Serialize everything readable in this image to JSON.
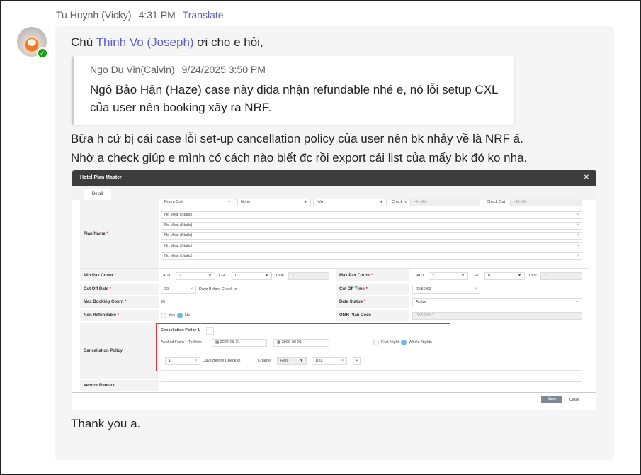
{
  "message": {
    "sender": "Tu Huynh (Vicky)",
    "time": "4:31 PM",
    "translate": "Translate",
    "line1_pre": "Chú ",
    "mention": "Thinh Vo (Joseph)",
    "line1_post": " ơi cho e hỏi,",
    "quote": {
      "author": "Ngo Du Vin(Calvin)",
      "time": "9/24/2025 3:50 PM",
      "text": "Ngô Bảo Hân (Haze) case này dida nhận refundable nhé e, nó lỗi setup CXL của user nên booking xãy ra NRF."
    },
    "line2": "Bữa h cứ bị cái case lỗi set-up cancellation policy của user nên bk nhảy về là NRF á.",
    "line3": "Nhờ a check giúp e mình có cách nào biết đc rồi export cái list của mấy bk đó ko nha.",
    "closing": "Thank you a."
  },
  "screenshot": {
    "title": "Hotel Plan Master",
    "tab": "Detail",
    "top_selects": [
      "Room Only",
      "None",
      "N/A"
    ],
    "check_in_label": "Check In",
    "check_in_ph": "HH:MM",
    "check_out_label": "Check Out",
    "check_out_ph": "HH:MM",
    "plan_name_label": "Plan Name",
    "plan_names": [
      "No Meal (Static)",
      "No Meal (Static)",
      "No Meal (Static)",
      "No Meal (Static)",
      "No Meal (Static)"
    ],
    "min_pax_label": "Min Pax Count",
    "max_pax_label": "Max Pax Count",
    "adt": "ADT",
    "chd": "CHD",
    "total": "Total",
    "adt_val": "2",
    "chd_val": "0",
    "total_val": "2",
    "cut_off_date_label": "Cut Off Date",
    "cut_off_date": "20",
    "days_before": "Days Before Check In",
    "cut_off_time_label": "Cut Off Time",
    "cut_off_time": "23:59:59",
    "max_booking_label": "Max Booking Count",
    "max_booking": "99",
    "data_status_label": "Data Status",
    "data_status": "Active",
    "non_ref_label": "Non Refundable",
    "yes": "Yes",
    "no": "No",
    "omh_label": "OMH Plan Code",
    "omh": "PAA22047",
    "cxl_label": "Cancellation Policy",
    "cxl_title": "Cancellation Policy 1",
    "applied": "Applied From ~ To Date",
    "from": "2024-08-21",
    "to": "2099-08-21",
    "first_night": "First Night",
    "whole_nights": "Whole Nights",
    "days": "1",
    "charge": "Charge",
    "charge_type": "Rate",
    "charge_val": "100",
    "vendor_label": "Vendor Remark",
    "save": "Save",
    "close": "Close"
  }
}
